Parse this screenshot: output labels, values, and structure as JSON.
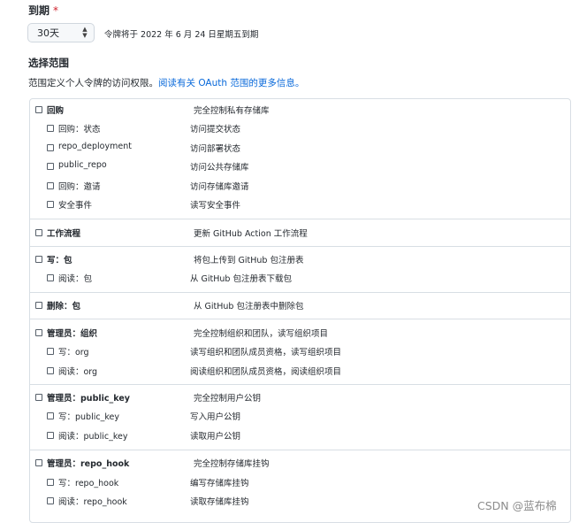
{
  "expiration": {
    "label": "到期",
    "required_mark": "*",
    "selected": "30天",
    "note": "令牌将于 2022 年 6 月 24 日星期五到期"
  },
  "scopes": {
    "title": "选择范围",
    "description": "范围定义个人令牌的访问权限。",
    "link_text": "阅读有关 OAuth 范围的更多信息。",
    "rows": [
      {
        "label": "回购",
        "desc": "完全控制私有存储库",
        "bold": true,
        "checked": false
      },
      {
        "label": "回购：状态",
        "desc": "访问提交状态",
        "bold": false,
        "checked": false
      },
      {
        "label": "repo_deployment",
        "desc": "访问部署状态",
        "bold": false,
        "checked": false
      },
      {
        "label": "public_repo",
        "desc": "访问公共存储库",
        "bold": false,
        "checked": false
      },
      {
        "label": "回购：邀请",
        "desc": "访问存储库邀请",
        "bold": false,
        "checked": false
      },
      {
        "label": "安全事件",
        "desc": "读写安全事件",
        "bold": false,
        "checked": false
      },
      {
        "label": "工作流程",
        "desc": "更新 GitHub Action 工作流程",
        "bold": true,
        "checked": false
      },
      {
        "label": "写：包",
        "desc": "将包上传到 GitHub 包注册表",
        "bold": true,
        "checked": false
      },
      {
        "label": "阅读：包",
        "desc": "从 GitHub 包注册表下载包",
        "bold": false,
        "checked": false
      },
      {
        "label": "删除：包",
        "desc": "从 GitHub 包注册表中删除包",
        "bold": true,
        "checked": false
      },
      {
        "label": "管理员：组织",
        "desc": "完全控制组织和团队，读写组织项目",
        "bold": true,
        "checked": false
      },
      {
        "label": "写：org",
        "desc": "读写组织和团队成员资格，读写组织项目",
        "bold": false,
        "checked": false
      },
      {
        "label": "阅读：org",
        "desc": "阅读组织和团队成员资格，阅读组织项目",
        "bold": false,
        "checked": false
      },
      {
        "label": "管理员：public_key",
        "desc": "完全控制用户公钥",
        "bold": true,
        "checked": false
      },
      {
        "label": "写：public_key",
        "desc": "写入用户公钥",
        "bold": false,
        "checked": false
      },
      {
        "label": "阅读：public_key",
        "desc": "读取用户公钥",
        "bold": false,
        "checked": false
      },
      {
        "label": "管理员：repo_hook",
        "desc": "完全控制存储库挂钩",
        "bold": true,
        "checked": false
      },
      {
        "label": "写：repo_hook",
        "desc": "编写存储库挂钩",
        "bold": false,
        "checked": false
      },
      {
        "label": "阅读：repo_hook",
        "desc": "读取存储库挂钩",
        "bold": false,
        "checked": false
      }
    ]
  },
  "watermark": "CSDN @蓝布棉"
}
